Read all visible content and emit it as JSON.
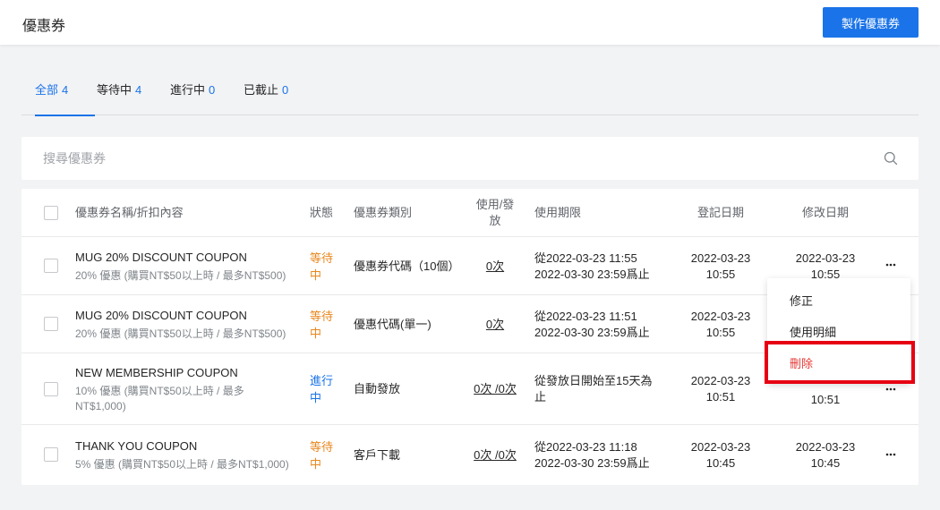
{
  "header": {
    "title": "優惠券",
    "create_button": "製作優惠券"
  },
  "tabs": [
    {
      "label": "全部",
      "count": "4",
      "active": true
    },
    {
      "label": "等待中",
      "count": "4",
      "active": false
    },
    {
      "label": "進行中",
      "count": "0",
      "active": false
    },
    {
      "label": "已截止",
      "count": "0",
      "active": false
    }
  ],
  "search": {
    "placeholder": "搜尋優惠券",
    "value": ""
  },
  "table": {
    "columns": {
      "name": "優惠券名稱/折扣內容",
      "status": "狀態",
      "type": "優惠券類別",
      "usage": "使用/發放",
      "period": "使用期限",
      "created": "登記日期",
      "modified": "修改日期"
    },
    "rows": [
      {
        "name": "MUG 20% DISCOUNT COUPON",
        "desc": "20% 優惠 (購買NT$50以上時 / 最多NT$500)",
        "status": "等待中",
        "type": "優惠券代碼（10個）",
        "usage": "0次",
        "period": "從2022-03-23 11:55 2022-03-30 23:59爲止",
        "created": "2022-03-23 10:55",
        "modified": "2022-03-23 10:55"
      },
      {
        "name": "MUG 20% DISCOUNT COUPON",
        "desc": "20% 優惠 (購買NT$50以上時 / 最多NT$500)",
        "status": "等待中",
        "type": "優惠代碼(單一)",
        "usage": "0次",
        "period": "從2022-03-23 11:51 2022-03-30 23:59爲止",
        "created": "2022-03-23 10:55",
        "modified": ""
      },
      {
        "name": "NEW MEMBERSHIP COUPON",
        "desc": "10% 優惠 (購買NT$50以上時 / 最多NT$1,000)",
        "status": "進行中",
        "type": "自動發放",
        "usage": "0次 /0次",
        "period": "從發放日開始至15天為止",
        "created": "2022-03-23 10:51",
        "modified": "10:51"
      },
      {
        "name": "THANK YOU COUPON",
        "desc": "5% 優惠 (購買NT$50以上時 / 最多NT$1,000)",
        "status": "等待中",
        "type": "客戶下載",
        "usage": "0次 /0次",
        "period": "從2022-03-23 11:18 2022-03-30 23:59爲止",
        "created": "2022-03-23 10:45",
        "modified": "2022-03-23 10:45"
      }
    ]
  },
  "dropdown_menu": {
    "items": [
      "修正",
      "使用明細",
      "刪除"
    ]
  },
  "colors": {
    "primary": "#1a73e8",
    "waiting": "#e8871e",
    "danger": "#e53935",
    "highlight": "#e60012"
  },
  "icons": {
    "search": "search-icon",
    "more": "more-horizontal-icon"
  }
}
